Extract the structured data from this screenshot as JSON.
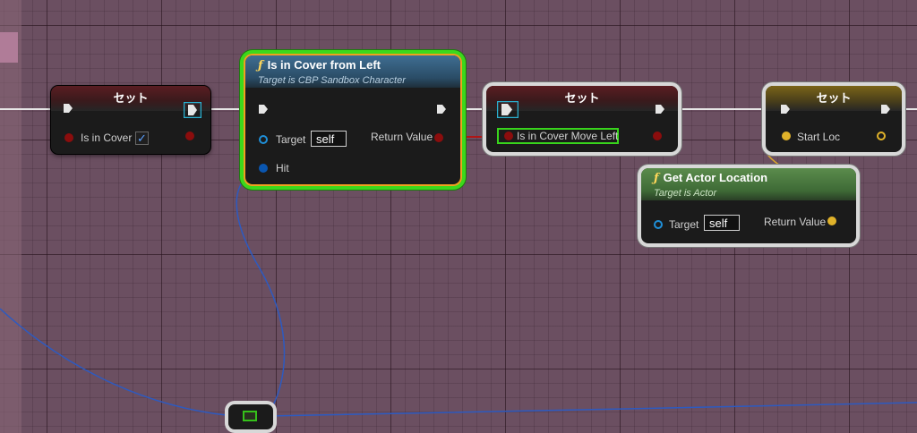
{
  "nodes": {
    "set_cover": {
      "title": "セット",
      "var_label": "Is in Cover",
      "checked_glyph": "✓"
    },
    "is_in_cover_left": {
      "title": "Is in Cover from Left",
      "subtitle": "Target is CBP Sandbox Character",
      "target_label": "Target",
      "target_value": "self",
      "hit_label": "Hit",
      "return_label": "Return Value"
    },
    "set_cover_move_left": {
      "title": "セット",
      "var_label": "Is in Cover Move Left"
    },
    "set_start_loc": {
      "title": "セット",
      "var_label": "Start Loc"
    },
    "get_actor_location": {
      "title": "Get Actor Location",
      "subtitle": "Target is Actor",
      "target_label": "Target",
      "target_value": "self",
      "return_label": "Return Value"
    },
    "function_glyph": "ƒ"
  },
  "colors": {
    "bool_pin": "#8b0d0d",
    "vector_pin": "#e0b22a",
    "object_pin": "#1f8fd8",
    "struct_hit_pin": "#0a56b0",
    "exec_pin": "#e6e6e6",
    "wire_blue": "#2d5ac0",
    "selection_green": "#38d41c"
  }
}
